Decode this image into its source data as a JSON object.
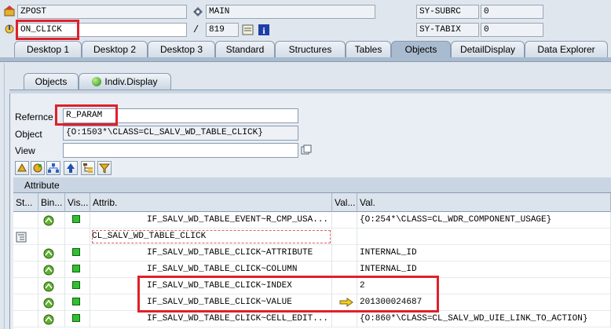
{
  "header": {
    "program": "ZPOST",
    "event": "ON_CLICK",
    "include": "MAIN",
    "separator": "/",
    "line": "819",
    "sys_fields": [
      {
        "name": "SY-SUBRC",
        "value": "0"
      },
      {
        "name": "SY-TABIX",
        "value": "0"
      }
    ]
  },
  "tabs": [
    "Desktop 1",
    "Desktop 2",
    "Desktop 3",
    "Standard",
    "Structures",
    "Tables",
    "Objects",
    "DetailDisplay",
    "Data Explorer"
  ],
  "active_tab": "Objects",
  "subtabs": [
    "Objects",
    "Indiv.Display"
  ],
  "active_subtab": "Indiv.Display",
  "form": {
    "reference_label": "Refernce",
    "reference_value": "R_PARAM",
    "object_label": "Object",
    "object_value": "{O:1503*\\CLASS=CL_SALV_WD_TABLE_CLICK}",
    "view_label": "View",
    "view_value": ""
  },
  "toolbar_icons": [
    "tool-a-icon",
    "tool-b-icon",
    "hierarchy-icon",
    "up-arrow-icon",
    "tree-icon",
    "filter-icon"
  ],
  "table": {
    "title": "Attribute",
    "columns": [
      "St...",
      "Bin...",
      "Vis...",
      "Attrib.",
      "Val...",
      "Val."
    ],
    "rows": [
      {
        "attrib": "IF_SALV_WD_TABLE_EVENT~R_CMP_USA...",
        "val": "{O:254*\\CLASS=CL_WDR_COMPONENT_USAGE}",
        "indent": true,
        "icons": true,
        "arrow": false
      },
      {
        "attrib": "CL_SALV_WD_TABLE_CLICK",
        "val": "",
        "indent": false,
        "icons": false,
        "arrow": false
      },
      {
        "attrib": "IF_SALV_WD_TABLE_CLICK~ATTRIBUTE",
        "val": "INTERNAL_ID",
        "indent": true,
        "icons": true,
        "arrow": false
      },
      {
        "attrib": "IF_SALV_WD_TABLE_CLICK~COLUMN",
        "val": "INTERNAL_ID",
        "indent": true,
        "icons": true,
        "arrow": false
      },
      {
        "attrib": "IF_SALV_WD_TABLE_CLICK~INDEX",
        "val": "2",
        "indent": true,
        "icons": true,
        "arrow": false
      },
      {
        "attrib": "IF_SALV_WD_TABLE_CLICK~VALUE",
        "val": "201300024687",
        "indent": true,
        "icons": true,
        "arrow": true
      },
      {
        "attrib": "IF_SALV_WD_TABLE_CLICK~CELL_EDIT...",
        "val": "{O:860*\\CLASS=CL_SALV_WD_UIE_LINK_TO_ACTION}",
        "indent": true,
        "icons": true,
        "arrow": false
      }
    ]
  },
  "colors": {
    "highlight": "#e0202a",
    "panel": "#dfe6ee",
    "tab_active": "#a9bbcf"
  }
}
